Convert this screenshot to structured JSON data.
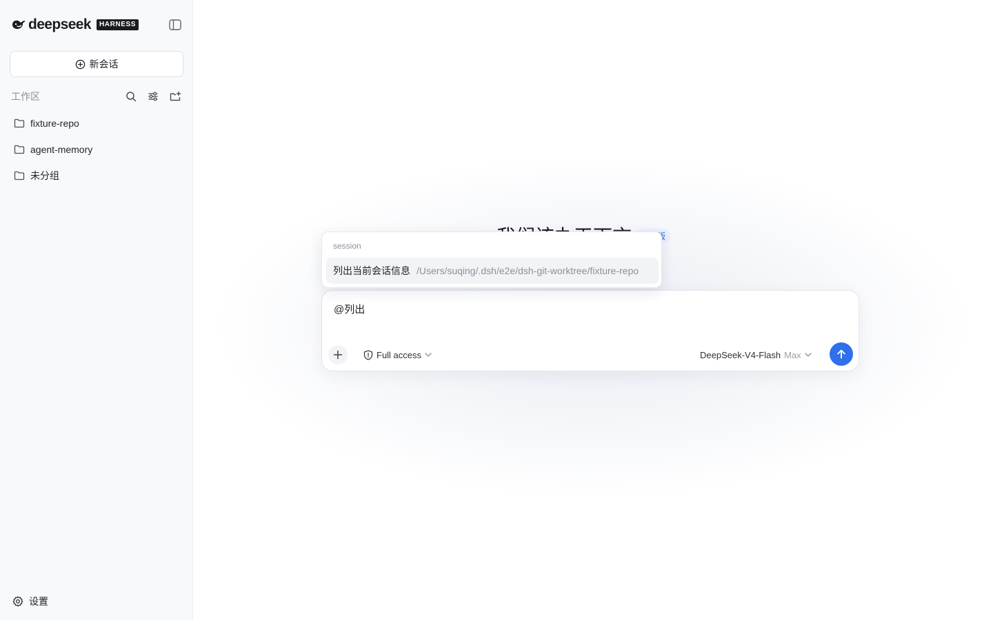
{
  "app": {
    "brand_name": "deepseek",
    "brand_badge": "HARNESS"
  },
  "sidebar": {
    "new_chat_label": "新会话",
    "workspace_title": "工作区",
    "folders": [
      {
        "label": "fixture-repo"
      },
      {
        "label": "agent-memory"
      },
      {
        "label": "未分组"
      }
    ],
    "settings_label": "设置"
  },
  "main": {
    "hero_title": "我们该办天下言",
    "hero_badge": "预览版",
    "composer": {
      "input_value": "@列出",
      "access_label": "Full access",
      "model_name": "DeepSeek-V4-Flash",
      "model_tier": "Max"
    },
    "mention_popup": {
      "group_label": "session",
      "items": [
        {
          "label": "列出当前会话信息",
          "path": "/Users/suqing/.dsh/e2e/dsh-git-worktree/fixture-repo"
        }
      ]
    }
  },
  "colors": {
    "accent": "#2f6fea",
    "sidebar_bg": "#f8f9fb",
    "muted_text": "#8b9099"
  }
}
